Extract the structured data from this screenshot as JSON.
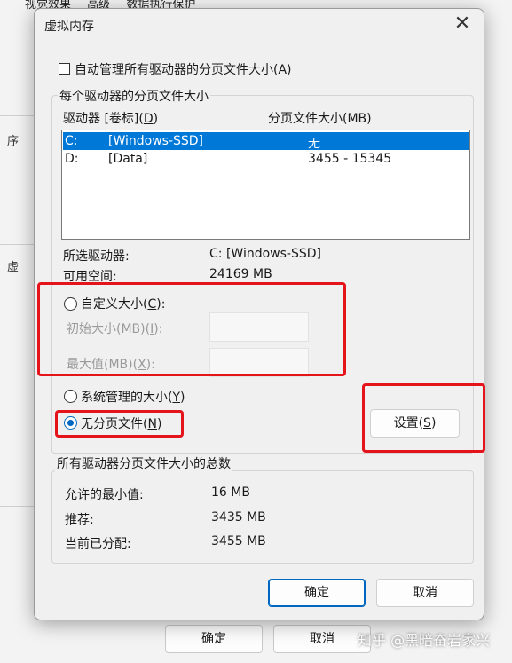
{
  "background": {
    "tabs": [
      "视觉效果",
      "高级",
      "数据执行保护"
    ],
    "buttons": {
      "ok": "确定",
      "cancel": "取消"
    },
    "fragments": [
      "序",
      "虚"
    ]
  },
  "watermark": "知乎 @黑暗奋岩家兴",
  "dialog": {
    "title": "虚拟内存",
    "close_glyph": "✕",
    "auto_manage_label": "自动管理所有驱动器的分页文件大小(",
    "auto_manage_key": "A",
    "auto_manage_checked": false,
    "per_drive_group": "每个驱动器的分页文件大小",
    "columns": {
      "drive": "驱动器 [卷标](",
      "drive_key": "D",
      "size": "分页文件大小(MB)"
    },
    "drives": [
      {
        "letter": "C:",
        "label": "[Windows-SSD]",
        "size": "无",
        "selected": true
      },
      {
        "letter": "D:",
        "label": "[Data]",
        "size": "3455 - 15345",
        "selected": false
      }
    ],
    "selected_drive_label": "所选驱动器:",
    "selected_drive_value": "C:  [Windows-SSD]",
    "free_space_label": "可用空间:",
    "free_space_value": "24169 MB",
    "custom_size": {
      "label": "自定义大小(",
      "key": "C",
      "suffix": "):"
    },
    "initial_size": {
      "label": "初始大小(MB)(",
      "key": "I",
      "suffix": "):"
    },
    "max_size": {
      "label": "最大值(MB)(",
      "key": "X",
      "suffix": "):"
    },
    "system_managed": {
      "label": "系统管理的大小(",
      "key": "Y",
      "suffix": ")"
    },
    "no_paging": {
      "label": "无分页文件(",
      "key": "N",
      "suffix": ")"
    },
    "selected_option": "no_paging",
    "set_button": {
      "label": "设置(",
      "key": "S",
      "suffix": ")"
    },
    "total_group": "所有驱动器分页文件大小的总数",
    "totals": [
      {
        "label": "允许的最小值:",
        "value": "16 MB"
      },
      {
        "label": "推荐:",
        "value": "3435 MB"
      },
      {
        "label": "当前已分配:",
        "value": "3455 MB"
      }
    ],
    "ok_label": "确定",
    "cancel_label": "取消"
  },
  "annotation_color": "#e5141b"
}
